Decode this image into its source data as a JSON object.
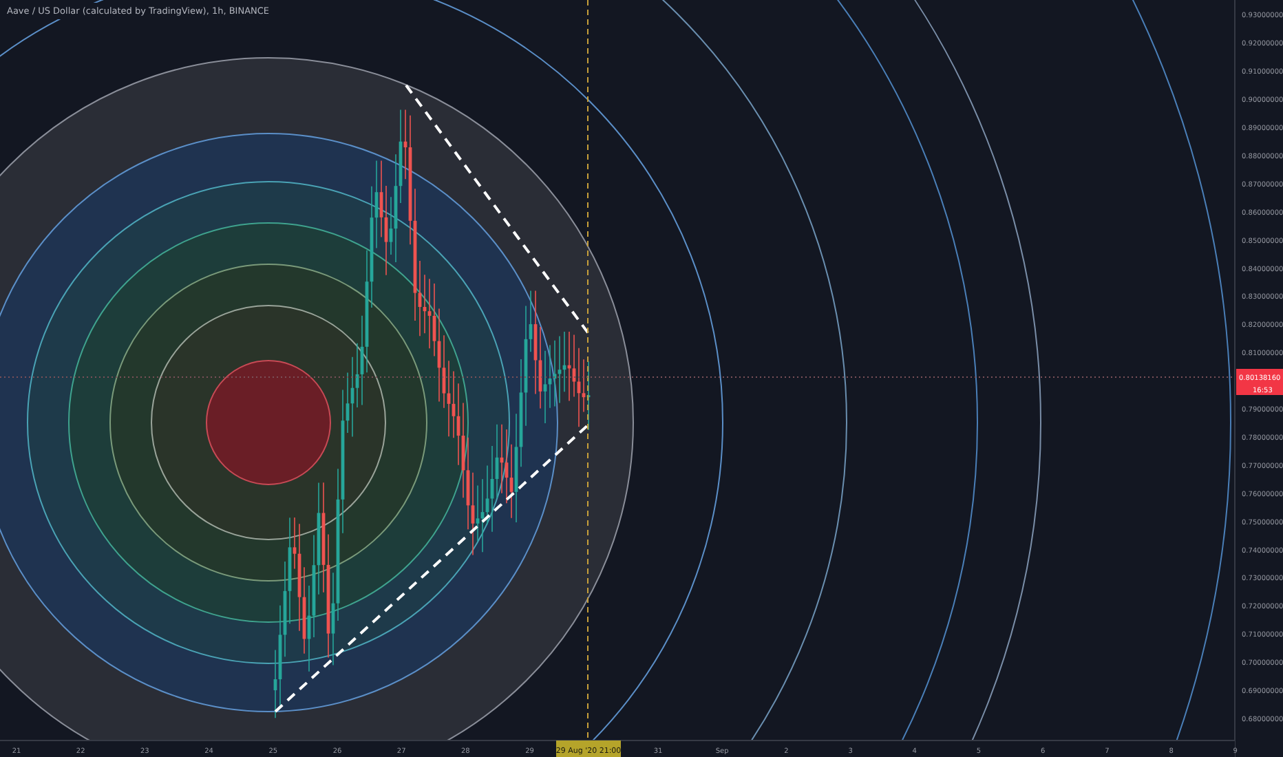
{
  "chart": {
    "title": "Aave / US Dollar (calculated by TradingView), 1h, BINANCE",
    "price_axis": [
      "0.93000000",
      "0.92000000",
      "0.91000000",
      "0.90000000",
      "0.89000000",
      "0.88000000",
      "0.87000000",
      "0.86000000",
      "0.85000000",
      "0.84000000",
      "0.83000000",
      "0.82000000",
      "0.81000000",
      "0.79000000",
      "0.78000000",
      "0.77000000",
      "0.76000000",
      "0.75000000",
      "0.74000000",
      "0.73000000",
      "0.72000000",
      "0.71000000",
      "0.70000000",
      "0.69000000",
      "0.68000000"
    ],
    "time_axis": [
      "21",
      "22",
      "23",
      "24",
      "25",
      "26",
      "27",
      "28",
      "29",
      "31",
      "Sep",
      "2",
      "3",
      "4",
      "5",
      "6",
      "7",
      "8",
      "9"
    ],
    "current_price": {
      "value": "0.80138160",
      "countdown": "16:53"
    },
    "crosshair_time": "29 Aug '20  21:00"
  }
}
